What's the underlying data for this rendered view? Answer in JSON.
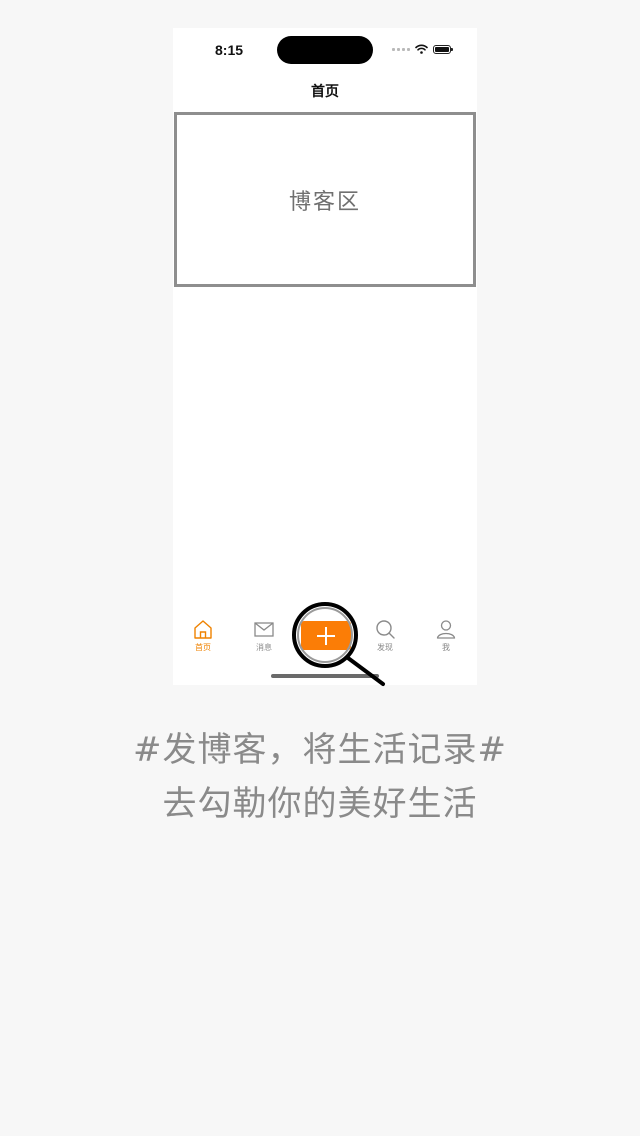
{
  "status_bar": {
    "time": "8:15",
    "icons": [
      "signal-icon",
      "wifi-icon",
      "battery-icon"
    ]
  },
  "nav": {
    "title": "首页"
  },
  "blog_area": {
    "label": "博客区"
  },
  "tabbar": {
    "accent_color": "#ef8200",
    "tabs": [
      {
        "label": "首页",
        "icon": "home-icon",
        "active": true
      },
      {
        "label": "消息",
        "icon": "mail-icon",
        "active": false
      },
      {
        "label": "",
        "icon": "plus-icon",
        "active": false
      },
      {
        "label": "发现",
        "icon": "search-icon",
        "active": false
      },
      {
        "label": "我",
        "icon": "person-icon",
        "active": false
      }
    ]
  },
  "add_button": {
    "color": "#fb7d06",
    "icon": "plus-icon"
  },
  "caption": {
    "line1": "#发博客，将生活记录#",
    "line2": "去勾勒你的美好生活"
  }
}
